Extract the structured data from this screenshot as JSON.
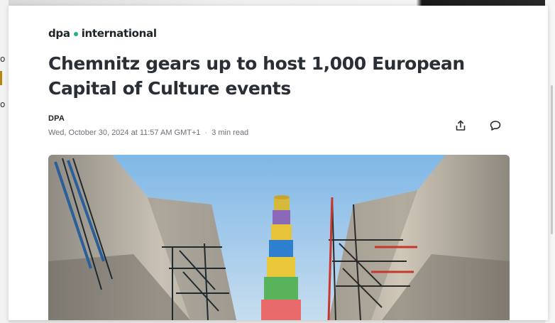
{
  "brand": {
    "name_left": "dpa",
    "name_right": "international",
    "accent_color": "#1bb28a"
  },
  "article": {
    "headline": "Chemnitz gears up to host 1,000 European Capital of Culture events",
    "author": "DPA",
    "published": "Wed, October 30, 2024 at 11:57 AM GMT+1",
    "separator": "·",
    "read_time": "3 min read"
  },
  "actions": {
    "share_icon": "share-icon",
    "comment_icon": "comment-icon"
  },
  "hero_image": {
    "subject": "colorful-chimney-between-cooling-towers",
    "chimney_colors": [
      "#d4b93a",
      "#8c68b8",
      "#e7c33a",
      "#2f7fd1",
      "#e9c83c",
      "#59b35a",
      "#e86a6a"
    ]
  }
}
